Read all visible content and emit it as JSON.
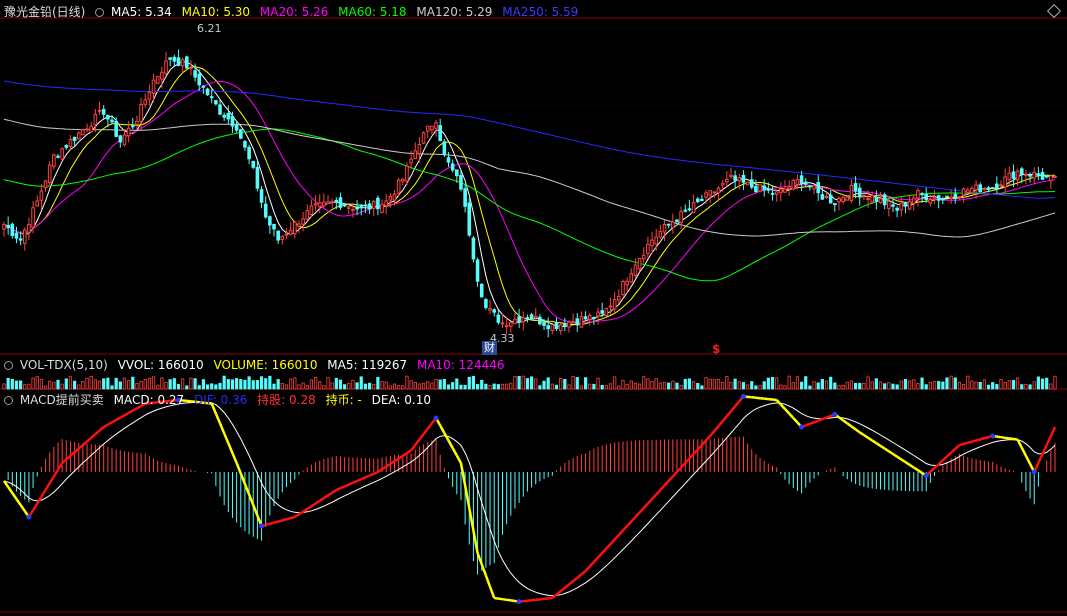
{
  "main": {
    "title": "豫光金铅(日线)",
    "ma5": "MA5: 5.34",
    "ma10": "MA10: 5.30",
    "ma20": "MA20: 5.26",
    "ma60": "MA60: 5.18",
    "ma120": "MA120: 5.29",
    "ma250": "MA250: 5.59",
    "high_label": "6.21",
    "low_label": "4.33",
    "cai_marker": "财",
    "dollar_marker": "$"
  },
  "vol": {
    "title": "VOL-TDX(5,10)",
    "vvol": "VVOL: 166010",
    "volume": "VOLUME: 166010",
    "ma5": "MA5: 119267",
    "ma10": "MA10: 124446"
  },
  "macd": {
    "title": "MACD提前买卖",
    "macd": "MACD: 0.27",
    "dif": "DIF: 0.36",
    "hold": "持股: 0.28",
    "coin": "持币: -",
    "dea": "DEA: 0.10"
  },
  "colors": {
    "bg": "#000000",
    "up": "#ff4040",
    "down": "#54fcfc",
    "ma5": "#ffffff",
    "ma10": "#ffff00",
    "ma20": "#ff00ff",
    "ma60": "#00ff00",
    "ma120": "#cccccc",
    "ma250": "#2828ff",
    "grid": "#8b0000"
  },
  "chart_data": {
    "type": "candlestick",
    "title": "豫光金铅(日线)",
    "price_range": [
      4.3,
      6.4
    ],
    "close_path": [
      [
        0,
        5.05
      ],
      [
        4,
        4.95
      ],
      [
        8,
        5.2
      ],
      [
        12,
        5.5
      ],
      [
        18,
        5.65
      ],
      [
        24,
        5.8
      ],
      [
        28,
        5.6
      ],
      [
        32,
        5.75
      ],
      [
        36,
        6.0
      ],
      [
        40,
        6.15
      ],
      [
        44,
        6.1
      ],
      [
        48,
        5.95
      ],
      [
        52,
        5.8
      ],
      [
        56,
        5.7
      ],
      [
        60,
        5.4
      ],
      [
        63,
        5.1
      ],
      [
        66,
        4.95
      ],
      [
        70,
        5.05
      ],
      [
        74,
        5.15
      ],
      [
        80,
        5.2
      ],
      [
        86,
        5.15
      ],
      [
        92,
        5.2
      ],
      [
        96,
        5.35
      ],
      [
        100,
        5.6
      ],
      [
        104,
        5.75
      ],
      [
        106,
        5.5
      ],
      [
        110,
        5.3
      ],
      [
        112,
        5.0
      ],
      [
        114,
        4.7
      ],
      [
        116,
        4.5
      ],
      [
        120,
        4.4
      ],
      [
        126,
        4.45
      ],
      [
        132,
        4.38
      ],
      [
        138,
        4.42
      ],
      [
        144,
        4.45
      ],
      [
        148,
        4.6
      ],
      [
        152,
        4.8
      ],
      [
        156,
        4.95
      ],
      [
        160,
        5.05
      ],
      [
        165,
        5.15
      ],
      [
        170,
        5.25
      ],
      [
        175,
        5.35
      ],
      [
        180,
        5.3
      ],
      [
        186,
        5.25
      ],
      [
        192,
        5.35
      ],
      [
        196,
        5.25
      ],
      [
        200,
        5.2
      ],
      [
        204,
        5.28
      ],
      [
        210,
        5.22
      ],
      [
        215,
        5.15
      ],
      [
        220,
        5.25
      ],
      [
        226,
        5.22
      ],
      [
        232,
        5.28
      ],
      [
        238,
        5.3
      ],
      [
        244,
        5.4
      ],
      [
        248,
        5.38
      ],
      [
        253,
        5.34
      ]
    ],
    "moving_averages": [
      "MA5",
      "MA10",
      "MA20",
      "MA60",
      "MA120",
      "MA250"
    ],
    "last_values": {
      "MA5": 5.34,
      "MA10": 5.3,
      "MA20": 5.26,
      "MA60": 5.18,
      "MA120": 5.29,
      "MA250": 5.59
    },
    "volume_last": 166010,
    "macd_last": {
      "MACD": 0.27,
      "DIF": 0.36,
      "DEA": 0.1
    },
    "macd_path": [
      [
        0,
        -0.05
      ],
      [
        6,
        -0.25
      ],
      [
        14,
        0.05
      ],
      [
        24,
        0.25
      ],
      [
        34,
        0.38
      ],
      [
        42,
        0.4
      ],
      [
        50,
        0.38
      ],
      [
        56,
        0.05
      ],
      [
        62,
        -0.3
      ],
      [
        70,
        -0.25
      ],
      [
        80,
        -0.1
      ],
      [
        90,
        0.0
      ],
      [
        98,
        0.12
      ],
      [
        104,
        0.3
      ],
      [
        110,
        0.05
      ],
      [
        114,
        -0.45
      ],
      [
        118,
        -0.7
      ],
      [
        124,
        -0.72
      ],
      [
        132,
        -0.7
      ],
      [
        140,
        -0.55
      ],
      [
        150,
        -0.3
      ],
      [
        160,
        -0.05
      ],
      [
        170,
        0.2
      ],
      [
        178,
        0.42
      ],
      [
        186,
        0.4
      ],
      [
        192,
        0.25
      ],
      [
        200,
        0.32
      ],
      [
        206,
        0.22
      ],
      [
        214,
        0.1
      ],
      [
        222,
        -0.02
      ],
      [
        230,
        0.15
      ],
      [
        238,
        0.2
      ],
      [
        244,
        0.18
      ],
      [
        248,
        0.0
      ],
      [
        253,
        0.25
      ]
    ]
  }
}
